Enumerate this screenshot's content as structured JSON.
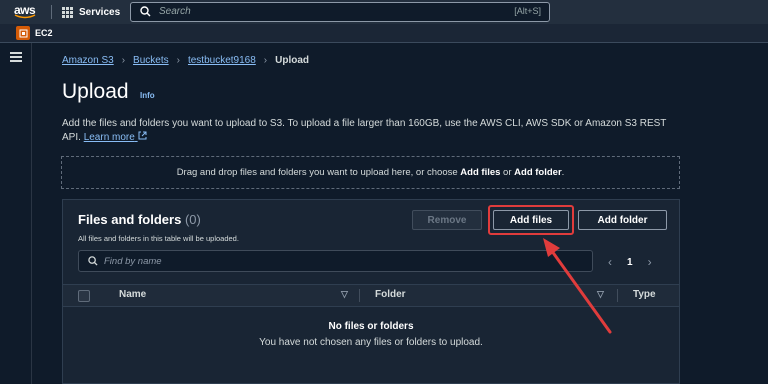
{
  "topnav": {
    "logo": "aws",
    "services_label": "Services",
    "search_placeholder": "Search",
    "search_shortcut": "[Alt+S]"
  },
  "favorites": {
    "ec2_label": "EC2"
  },
  "breadcrumb": [
    "Amazon S3",
    "Buckets",
    "testbucket9168",
    "Upload"
  ],
  "page": {
    "title": "Upload",
    "info_link": "Info",
    "description": "Add the files and folders you want to upload to S3. To upload a file larger than 160GB, use the AWS CLI, AWS SDK or Amazon S3 REST API.",
    "learn_more": "Learn more"
  },
  "dropzone": {
    "text_before": "Drag and drop files and folders you want to upload here, or choose ",
    "add_files": "Add files",
    "or": " or ",
    "add_folder": "Add folder",
    "end": "."
  },
  "files_panel": {
    "title": "Files and folders",
    "count": "(0)",
    "subtitle": "All files and folders in this table will be uploaded.",
    "remove_label": "Remove",
    "add_files_label": "Add files",
    "add_folder_label": "Add folder",
    "search_placeholder": "Find by name",
    "page_number": "1",
    "columns": [
      "Name",
      "Folder",
      "Type"
    ],
    "empty_title": "No files or folders",
    "empty_subtitle": "You have not chosen any files or folders to upload."
  },
  "colors": {
    "accent_link": "#89bdf5",
    "annotation_red": "#e03c3c",
    "ec2_orange": "#d45b07"
  }
}
